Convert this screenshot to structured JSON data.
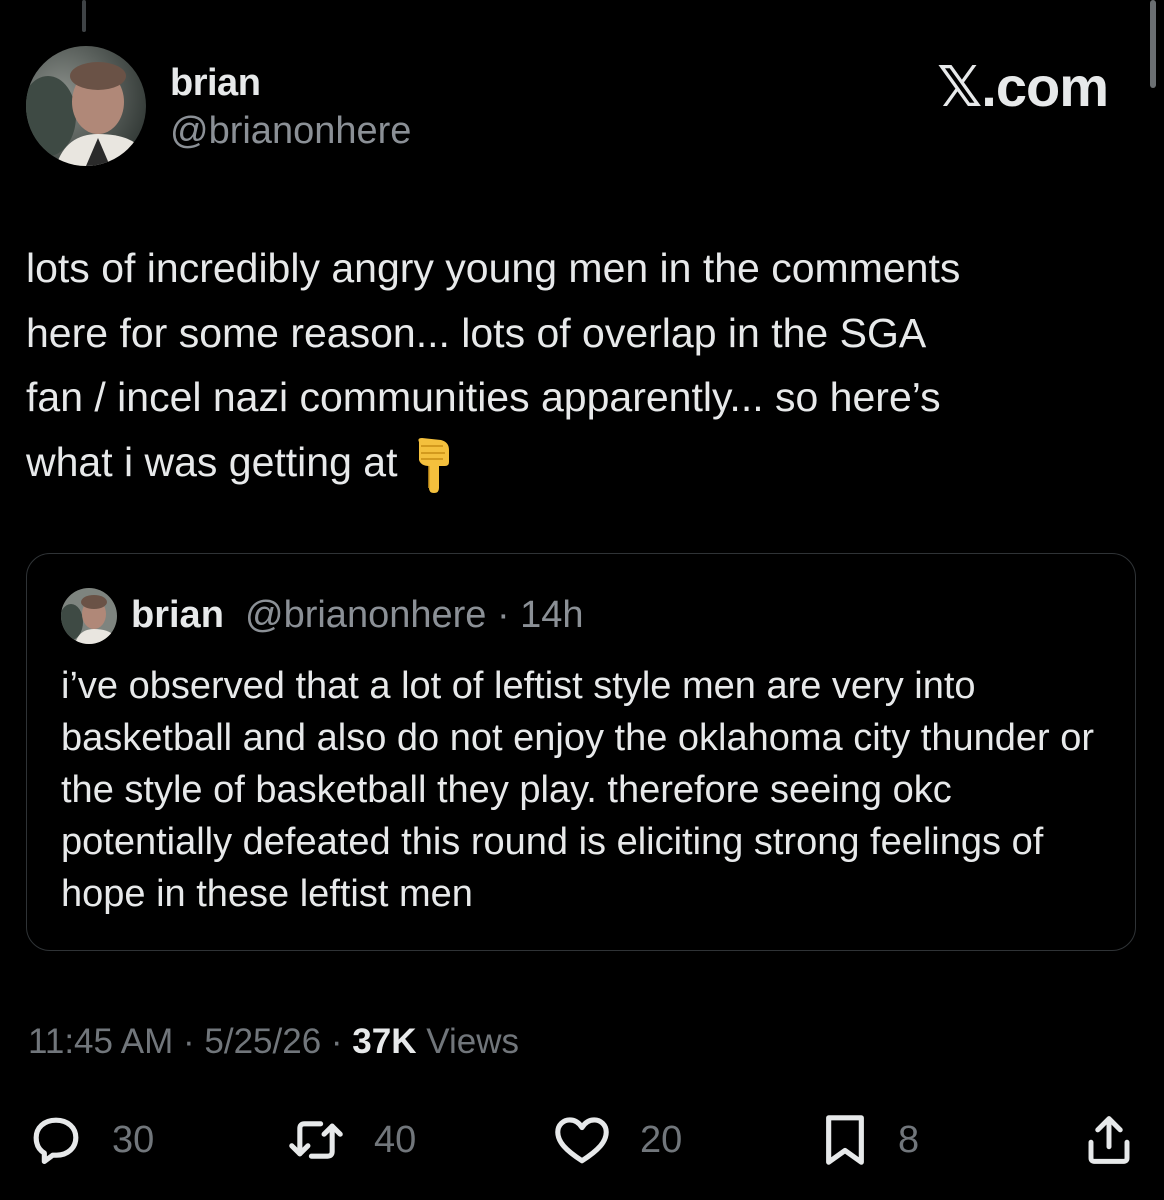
{
  "author": {
    "display_name": "brian",
    "handle": "@brianonhere"
  },
  "site_logo": "𝕏.com",
  "tweet": {
    "text": "lots of incredibly angry young men in the comments\nhere for some reason... lots of overlap in the SGA\nfan / incel nazi communities apparently... so here’s\nwhat i was getting at",
    "emoji": "point-down-emoji"
  },
  "quote": {
    "display_name": "brian",
    "meta": "@brianonhere · 14h",
    "text": "i’ve observed that a lot of leftist style men are very into basketball and also do not enjoy the oklahoma city thunder or the style of basketball they play. therefore seeing okc potentially defeated this round is eliciting strong feelings of hope in these leftist men"
  },
  "meta": {
    "time": "11:45 AM",
    "date": "5/25/26",
    "views_count": "37K",
    "views_label": "Views"
  },
  "actions": {
    "replies": "30",
    "reposts": "40",
    "likes": "20",
    "bookmarks": "8"
  },
  "colors": {
    "background": "#000000",
    "primary_text": "#e7e9ea",
    "secondary_text": "#71767b",
    "border": "#2f3336"
  }
}
